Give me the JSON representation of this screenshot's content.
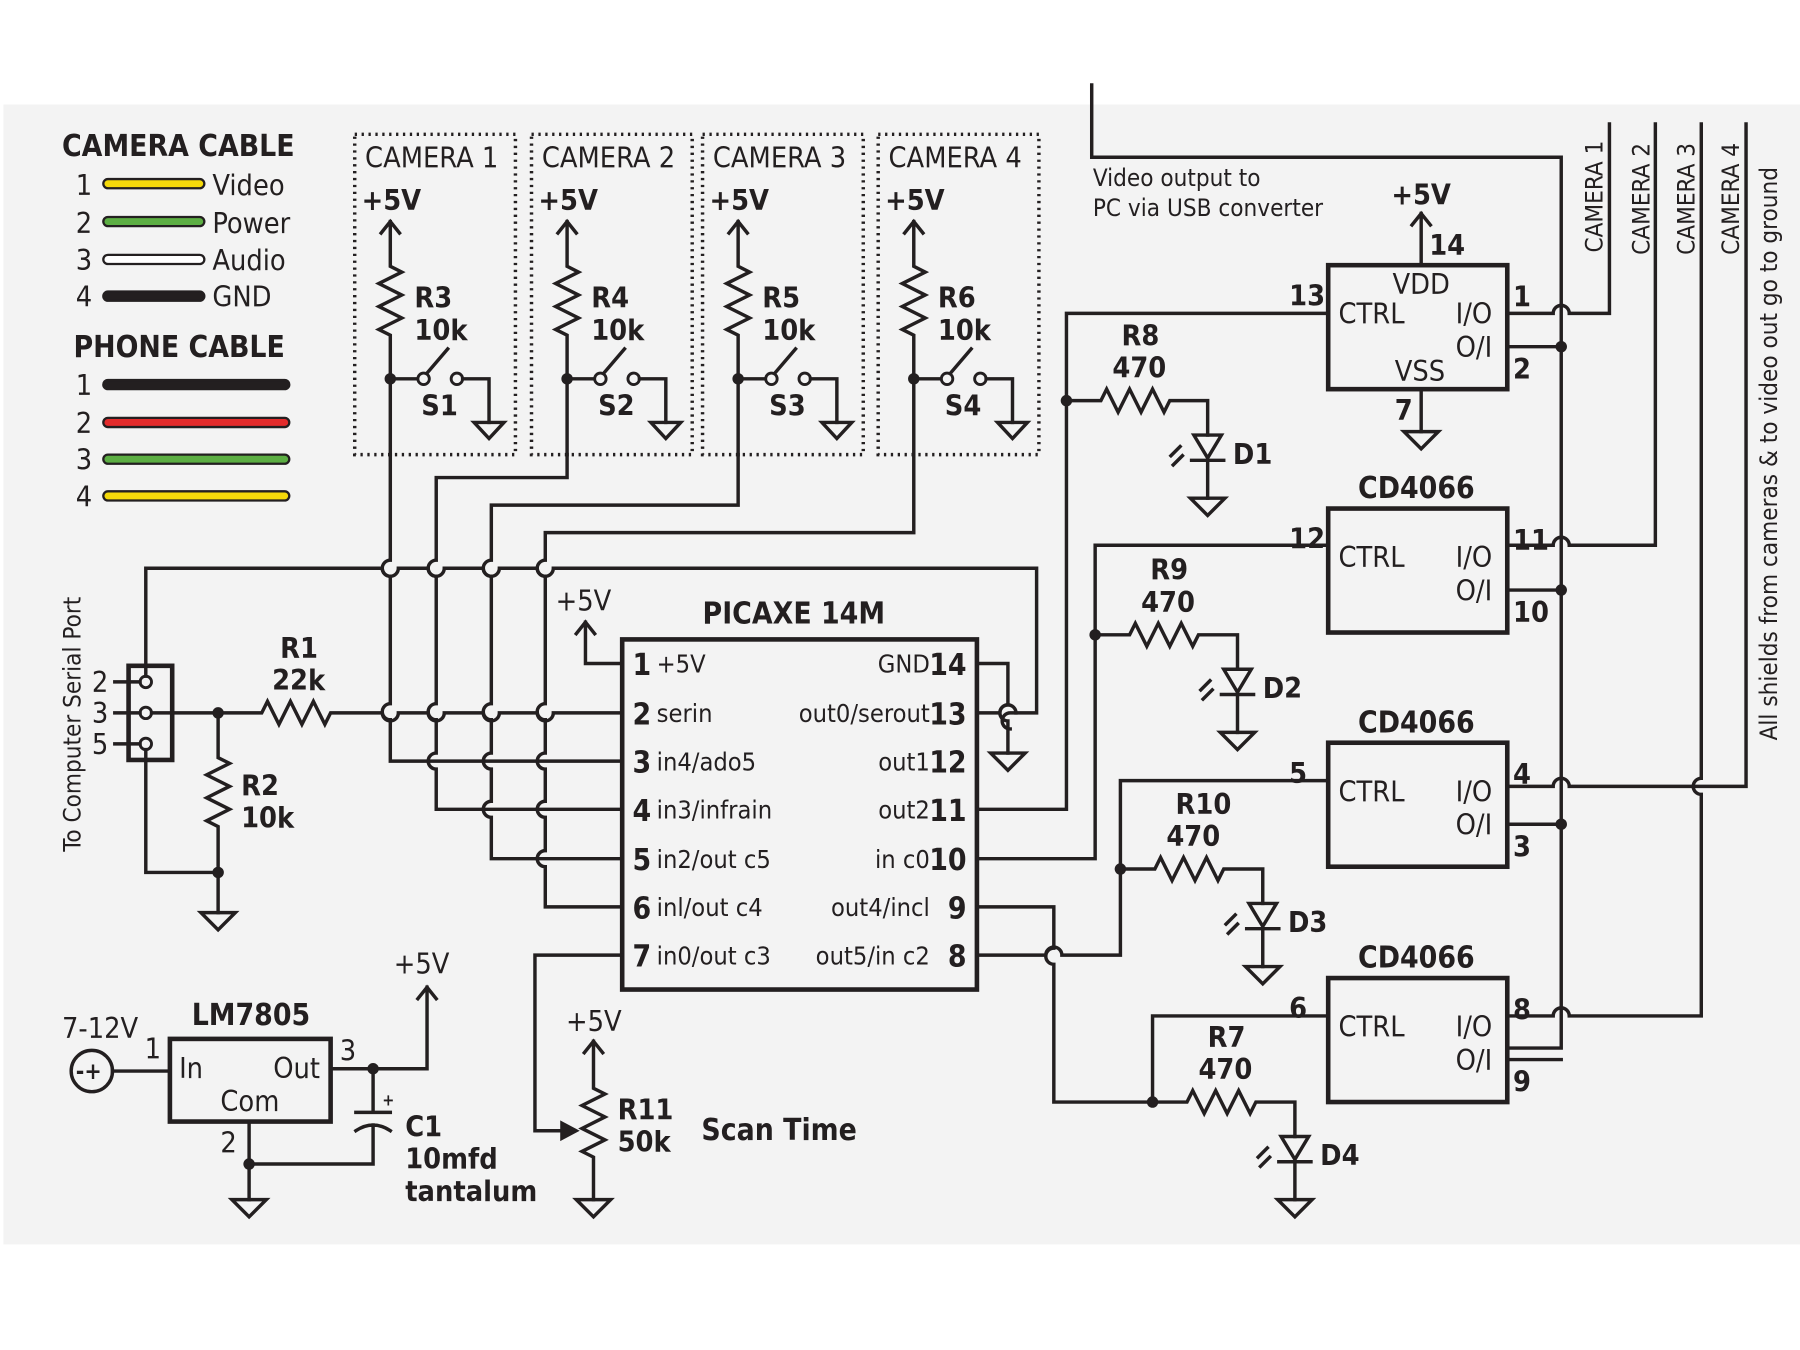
{
  "legend": {
    "camera_cable": {
      "title": "CAMERA CABLE",
      "wires": [
        {
          "num": "1",
          "label": "Video",
          "color": "#f5d90a"
        },
        {
          "num": "2",
          "label": "Power",
          "color": "#5cae43"
        },
        {
          "num": "3",
          "label": "Audio",
          "color": "#ffffff"
        },
        {
          "num": "4",
          "label": "GND",
          "color": "#231f20"
        }
      ]
    },
    "phone_cable": {
      "title": "PHONE CABLE",
      "wires": [
        {
          "num": "1",
          "color": "#231f20"
        },
        {
          "num": "2",
          "color": "#e32b2b"
        },
        {
          "num": "3",
          "color": "#5cae43"
        },
        {
          "num": "4",
          "color": "#f5d90a"
        }
      ]
    }
  },
  "camera_blocks": [
    {
      "title": "CAMERA 1",
      "supply": "+5V",
      "resistor": "R3",
      "value": "10k",
      "switch": "S1"
    },
    {
      "title": "CAMERA 2",
      "supply": "+5V",
      "resistor": "R4",
      "value": "10k",
      "switch": "S2"
    },
    {
      "title": "CAMERA 3",
      "supply": "+5V",
      "resistor": "R5",
      "value": "10k",
      "switch": "S3"
    },
    {
      "title": "CAMERA 4",
      "supply": "+5V",
      "resistor": "R6",
      "value": "10k",
      "switch": "S4"
    }
  ],
  "serial": {
    "label": "To Computer Serial Port",
    "pins": [
      "2",
      "3",
      "5"
    ],
    "r1": {
      "name": "R1",
      "value": "22k"
    },
    "r2": {
      "name": "R2",
      "value": "10k"
    }
  },
  "picaxe": {
    "title": "PICAXE 14M",
    "supply": "+5V",
    "left_pins": [
      {
        "num": "1",
        "label": "+5V"
      },
      {
        "num": "2",
        "label": "serin"
      },
      {
        "num": "3",
        "label": "in4/ado5"
      },
      {
        "num": "4",
        "label": "in3/infrain"
      },
      {
        "num": "5",
        "label": "in2/out c5"
      },
      {
        "num": "6",
        "label": "inl/out c4"
      },
      {
        "num": "7",
        "label": "in0/out c3"
      }
    ],
    "right_pins": [
      {
        "num": "14",
        "label": "GND"
      },
      {
        "num": "13",
        "label": "out0/serout"
      },
      {
        "num": "12",
        "label": "out1"
      },
      {
        "num": "11",
        "label": "out2"
      },
      {
        "num": "10",
        "label": "in c0"
      },
      {
        "num": "9",
        "label": "out4/incl"
      },
      {
        "num": "8",
        "label": "out5/in c2"
      }
    ]
  },
  "regulator": {
    "title": "LM7805",
    "input": "7-12V",
    "in_label": "In",
    "out_label": "Out",
    "com_label": "Com",
    "pin_in": "1",
    "pin_com": "2",
    "pin_out": "3",
    "out_supply": "+5V",
    "cap": {
      "name": "C1",
      "value": "10mfd",
      "type": "tantalum"
    }
  },
  "pot": {
    "supply": "+5V",
    "name": "R11",
    "value": "50k",
    "caption": "Scan Time"
  },
  "video_out": {
    "line1": "Video output to",
    "line2": "PC via USB converter"
  },
  "switches": [
    {
      "title": "",
      "supply": "+5V",
      "vdd": "VDD",
      "vss": "VSS",
      "pin_vdd": "14",
      "pin_vss": "7",
      "ctrl": "CTRL",
      "io": "I/O",
      "oi": "O/I",
      "pin_ctrl": "13",
      "pin_io": "1",
      "pin_oi": "2",
      "resistor": "R8",
      "value": "470",
      "led": "D1"
    },
    {
      "title": "CD4066",
      "ctrl": "CTRL",
      "io": "I/O",
      "oi": "O/I",
      "pin_ctrl": "12",
      "pin_io": "11",
      "pin_oi": "10",
      "resistor": "R9",
      "value": "470",
      "led": "D2"
    },
    {
      "title": "CD4066",
      "ctrl": "CTRL",
      "io": "I/O",
      "oi": "O/I",
      "pin_ctrl": "5",
      "pin_io": "4",
      "pin_oi": "3",
      "resistor": "R10",
      "value": "470",
      "led": "D3"
    },
    {
      "title": "CD4066",
      "ctrl": "CTRL",
      "io": "I/O",
      "oi": "O/I",
      "pin_ctrl": "6",
      "pin_io": "8",
      "pin_oi": "9",
      "resistor": "R7",
      "value": "470",
      "led": "D4"
    }
  ],
  "camera_inputs": [
    "CAMERA 1",
    "CAMERA 2",
    "CAMERA 3",
    "CAMERA 4"
  ],
  "shield_note": "All shields from cameras & to video out go to ground"
}
